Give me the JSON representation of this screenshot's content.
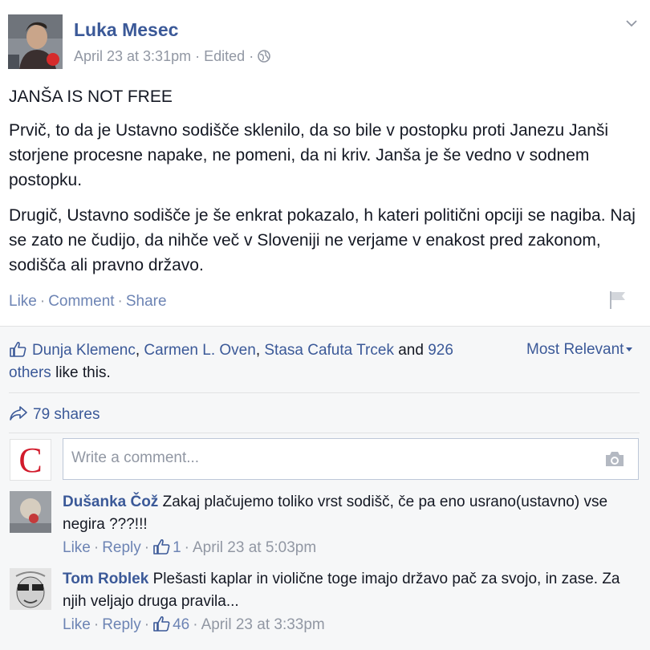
{
  "post": {
    "author": "Luka Mesec",
    "timestamp": "April 23 at 3:31pm",
    "edited": "Edited",
    "dot": "·",
    "headline": "JANŠA IS NOT FREE",
    "paragraph1": "Prvič, to da je Ustavno sodišče sklenilo, da so bile v postopku proti Janezu Janši storjene procesne napake, ne pomeni, da ni kriv. Janša je še vedno v sodnem postopku.",
    "paragraph2": "Drugič, Ustavno sodišče je še enkrat pokazalo, h kateri politični opciji se nagiba. Naj se zato ne čudijo, da nihče več v Sloveniji ne verjame v enakost pred zakonom, sodišča ali pravno državo."
  },
  "actions": {
    "like": "Like",
    "comment": "Comment",
    "share": "Share",
    "sep": "·"
  },
  "likes": {
    "user1": "Dunja Klemenc",
    "comma1": ",",
    "user2": "Carmen L. Oven",
    "comma2": ",",
    "user3": "Stasa Cafuta Trcek",
    "and": "and",
    "others_link": "926 others",
    "suffix": "like this."
  },
  "sort": {
    "label": "Most Relevant"
  },
  "shares": {
    "label": "79 shares"
  },
  "composer": {
    "placeholder": "Write a comment...",
    "avatar_letter": "C"
  },
  "comments": [
    {
      "name": "Dušanka Čož",
      "text": "Zakaj plačujemo toliko vrst sodišč, če pa eno usrano(ustavno) vse negira ???!!!",
      "like": "Like",
      "reply": "Reply",
      "likes_count": "1",
      "date": "April 23 at 5:03pm"
    },
    {
      "name": "Tom Roblek",
      "text": "Plešasti kaplar in violične toge imajo državo pač za svojo, in zase. Za njih veljajo druga pravila...",
      "like": "Like",
      "reply": "Reply",
      "likes_count": "46",
      "date": "April 23 at 3:33pm"
    }
  ],
  "colors": {
    "link": "#3b5998",
    "grey": "#9197a3",
    "feedback_bg": "#f6f7f8"
  },
  "icons": [
    "globe-icon",
    "chevron-down-icon",
    "flag-icon",
    "thumbs-up-icon",
    "share-arrow-icon",
    "camera-icon"
  ]
}
